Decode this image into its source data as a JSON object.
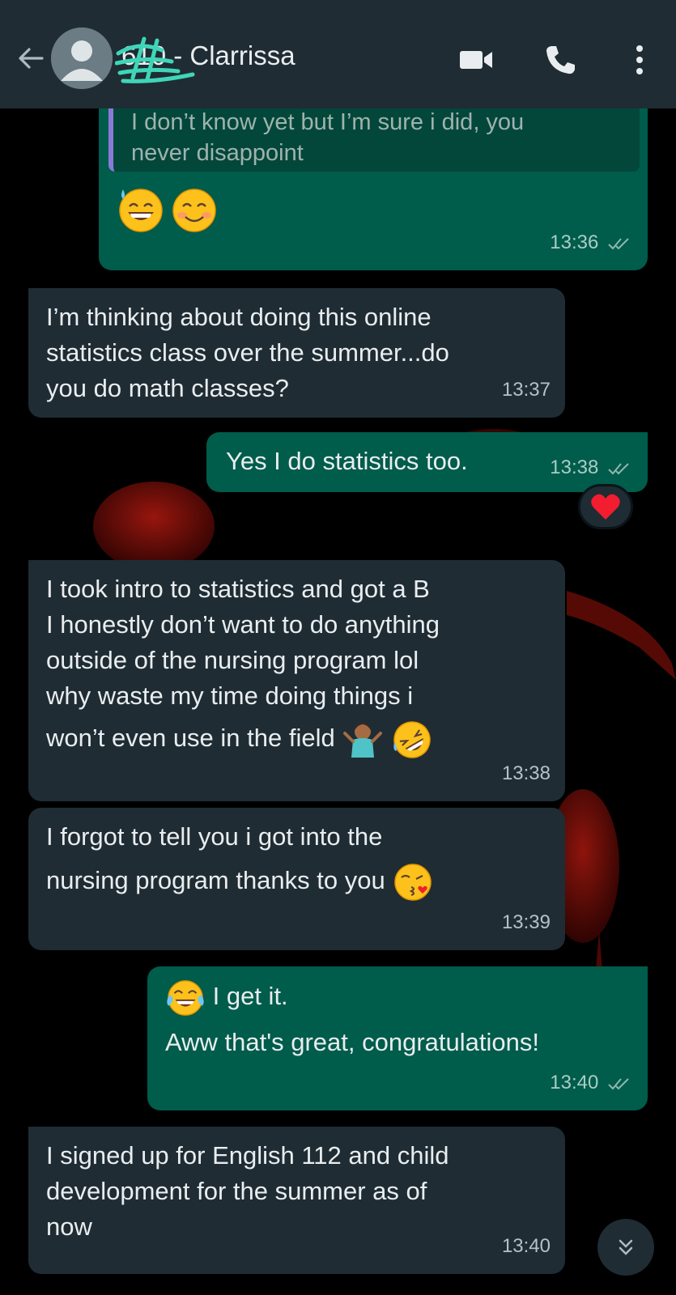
{
  "header": {
    "contact_name": "610 - Clarrissa",
    "icons": [
      "back-arrow-icon",
      "avatar-icon",
      "video-call-icon",
      "phone-icon",
      "more-options-icon"
    ]
  },
  "colors": {
    "header_bg": "#1f2c34",
    "incoming_bubble": "#1f2c34",
    "outgoing_bubble": "#005c4b",
    "read_ticks": "#8fb8ad"
  },
  "messages": [
    {
      "direction": "out",
      "quoted_text_line1": "I don’t know yet but I’m sure i did, you",
      "quoted_text_line2": "never disappoint",
      "emojis": [
        "sweat-smile-emoji",
        "smiling-face-emoji"
      ],
      "time": "13:36",
      "status": "read"
    },
    {
      "direction": "in",
      "lines": [
        "I’m thinking about doing this online",
        "statistics class over the summer...do",
        "you do math classes?"
      ],
      "time": "13:37"
    },
    {
      "direction": "out",
      "lines": [
        "Yes I do statistics too."
      ],
      "time": "13:38",
      "status": "read",
      "reaction": "red-heart"
    },
    {
      "direction": "in",
      "lines": [
        "I took intro to statistics and got a B",
        "I honestly don’t want to do anything",
        "outside of the nursing program lol",
        "why waste my time doing things i",
        "won’t even use in the field"
      ],
      "emojis": [
        "shrug-emoji",
        "rolling-laughing-emoji"
      ],
      "time": "13:38"
    },
    {
      "direction": "in",
      "lines": [
        "I forgot to tell you i got into the",
        "nursing program thanks to you"
      ],
      "emojis": [
        "kiss-emoji"
      ],
      "time": "13:39"
    },
    {
      "direction": "out",
      "lines": [
        "I get it.",
        "Aww that's great, congratulations!"
      ],
      "emojis": [
        "tears-of-joy-emoji"
      ],
      "time": "13:40",
      "status": "read"
    },
    {
      "direction": "in",
      "lines": [
        "I signed up for English 112 and child",
        "development for the summer as of",
        "now"
      ],
      "time": "13:40"
    }
  ]
}
